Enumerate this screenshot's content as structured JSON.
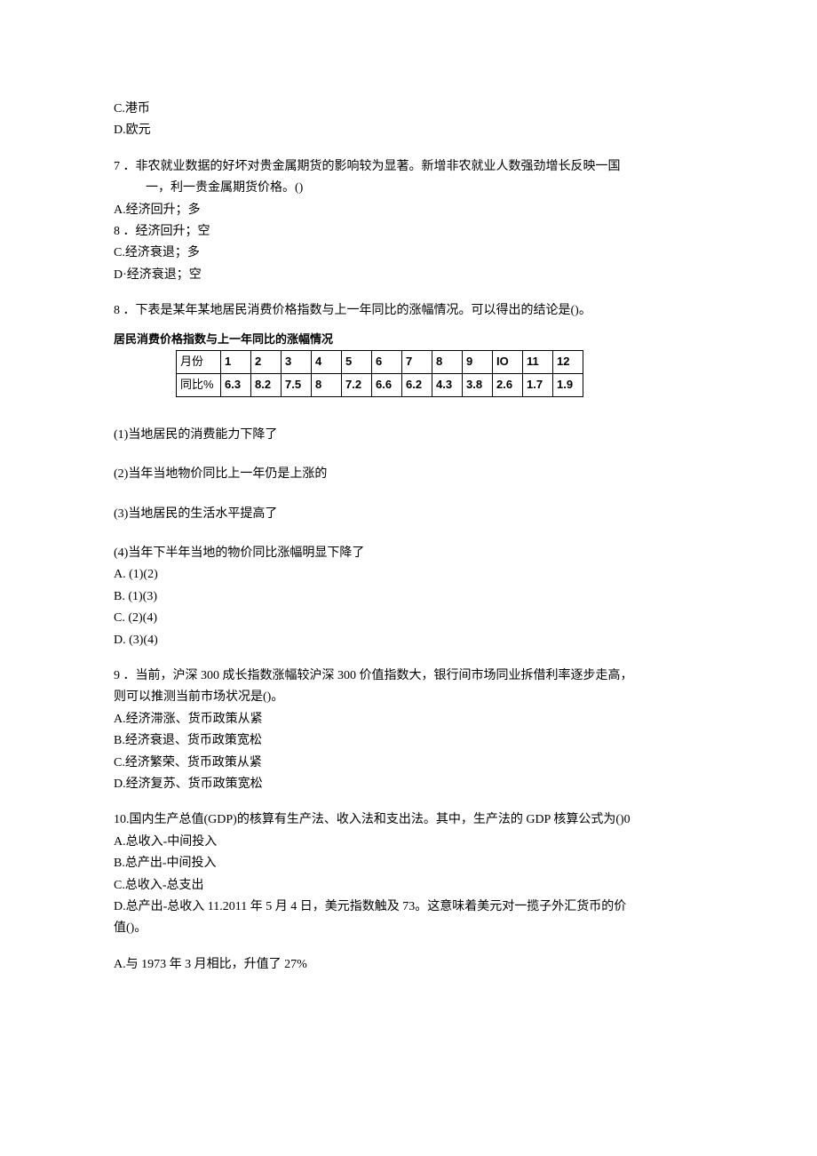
{
  "q6": {
    "optC": "C.港币",
    "optD": "D.欧元"
  },
  "q7": {
    "stem1": "7 ．非农就业数据的好坏对贵金属期货的影响较为显著。新增非农就业人数强劲增长反映一国",
    "stem2": "一，利一贵金属期货价格。()",
    "optA": "A.经济回升；多",
    "optB": "8 ．经济回升；空",
    "optC": "C.经济衰退；多",
    "optD": "D·经济衰退；空"
  },
  "q8": {
    "stem": "8 ．下表是某年某地居民消费价格指数与上一年同比的涨幅情况。可以得出的结论是()。",
    "tableTitle": "居民消费价格指数与上一年同比的涨幅情况",
    "rowHdr1": "月份",
    "rowHdr2": "同比%",
    "s1": "(1)当地居民的消费能力下降了",
    "s2": "(2)当年当地物价同比上一年仍是上涨的",
    "s3": "(3)当地居民的生活水平提高了",
    "s4": "(4)当年下半年当地的物价同比涨幅明显下降了",
    "optA": "A.   (1)(2)",
    "optB": "B.   (1)(3)",
    "optC": "C.   (2)(4)",
    "optD": "D.   (3)(4)"
  },
  "q9": {
    "stem1": "9 ．当前，沪深 300 成长指数涨幅较沪深 300 价值指数大，银行间市场同业拆借利率逐步走高，",
    "stem2": "则可以推测当前市场状况是()。",
    "optA": "A.经济滞涨、货币政策从紧",
    "optB": "B.经济衰退、货币政策宽松",
    "optC": "C.经济繁荣、货币政策从紧",
    "optD": "D.经济复苏、货币政策宽松"
  },
  "q10": {
    "stem": "10.国内生产总值(GDP)的核算有生产法、收入法和支出法。其中，生产法的 GDP 核算公式为()0",
    "optA": "A.总收入-中间投入",
    "optB": "B.总产出-中间投入",
    "optC": "C.总收入-总支出",
    "optD": "D.总产出-总收入 11.2011 年 5 月 4 日，美元指数触及 73。这意味着美元对一揽子外汇货币的价",
    "optD2": "值()。"
  },
  "q11": {
    "optA": "A.与 1973 年 3 月相比，升值了 27%"
  },
  "chart_data": {
    "type": "table",
    "title": "居民消费价格指数与上一年同比的涨幅情况",
    "xlabel": "月份",
    "ylabel": "同比%",
    "categories": [
      "1",
      "2",
      "3",
      "4",
      "5",
      "6",
      "7",
      "8",
      "9",
      "IO",
      "11",
      "12"
    ],
    "values": [
      6.3,
      8.2,
      7.5,
      8.0,
      7.2,
      6.6,
      6.2,
      4.3,
      3.8,
      2.6,
      1.7,
      1.9
    ]
  }
}
